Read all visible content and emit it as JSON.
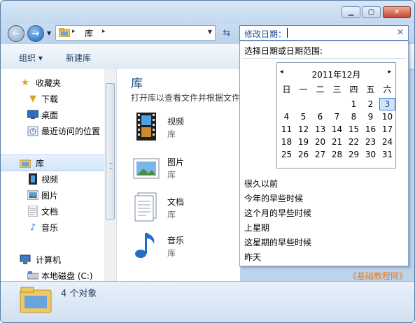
{
  "titlebar": {
    "min_label": "▁",
    "max_label": "▢",
    "close_label": "✕"
  },
  "address": {
    "crumb": "库",
    "arrow": "▸"
  },
  "search": {
    "label": "修改日期：",
    "clear": "✕"
  },
  "toolbar": {
    "organize": "组织 ▾",
    "new_library": "新建库"
  },
  "navpane": {
    "favorites": "收藏夹",
    "downloads": "下载",
    "desktop": "桌面",
    "recent": "最近访问的位置",
    "libraries": "库",
    "videos": "视频",
    "pictures": "图片",
    "documents": "文档",
    "music": "音乐",
    "computer": "计算机",
    "local_disk": "本地磁盘 (C:)"
  },
  "content": {
    "title": "库",
    "subtitle": "打开库以查看文件并根据文件",
    "items": [
      {
        "name": "视频",
        "type": "库"
      },
      {
        "name": "图片",
        "type": "库"
      },
      {
        "name": "文档",
        "type": "库"
      },
      {
        "name": "音乐",
        "type": "库"
      }
    ]
  },
  "status": {
    "count": "4 个对象"
  },
  "dropdown": {
    "prompt": "选择日期或日期范围:",
    "calendar": {
      "month": "2011年12月",
      "prev": "◂",
      "next": "▸",
      "weekdays": [
        "日",
        "一",
        "二",
        "三",
        "四",
        "五",
        "六"
      ],
      "weeks": [
        [
          "",
          "",
          "",
          "",
          "1",
          "2",
          "3"
        ],
        [
          "4",
          "5",
          "6",
          "7",
          "8",
          "9",
          "10"
        ],
        [
          "11",
          "12",
          "13",
          "14",
          "15",
          "16",
          "17"
        ],
        [
          "18",
          "19",
          "20",
          "21",
          "22",
          "23",
          "24"
        ],
        [
          "25",
          "26",
          "27",
          "28",
          "29",
          "30",
          "31"
        ]
      ],
      "selected": "3"
    },
    "quick_options": [
      "很久以前",
      "今年的早些时候",
      "这个月的早些时候",
      "上星期",
      "这星期的早些时候",
      "昨天"
    ]
  },
  "watermark": "《基础教程网》"
}
